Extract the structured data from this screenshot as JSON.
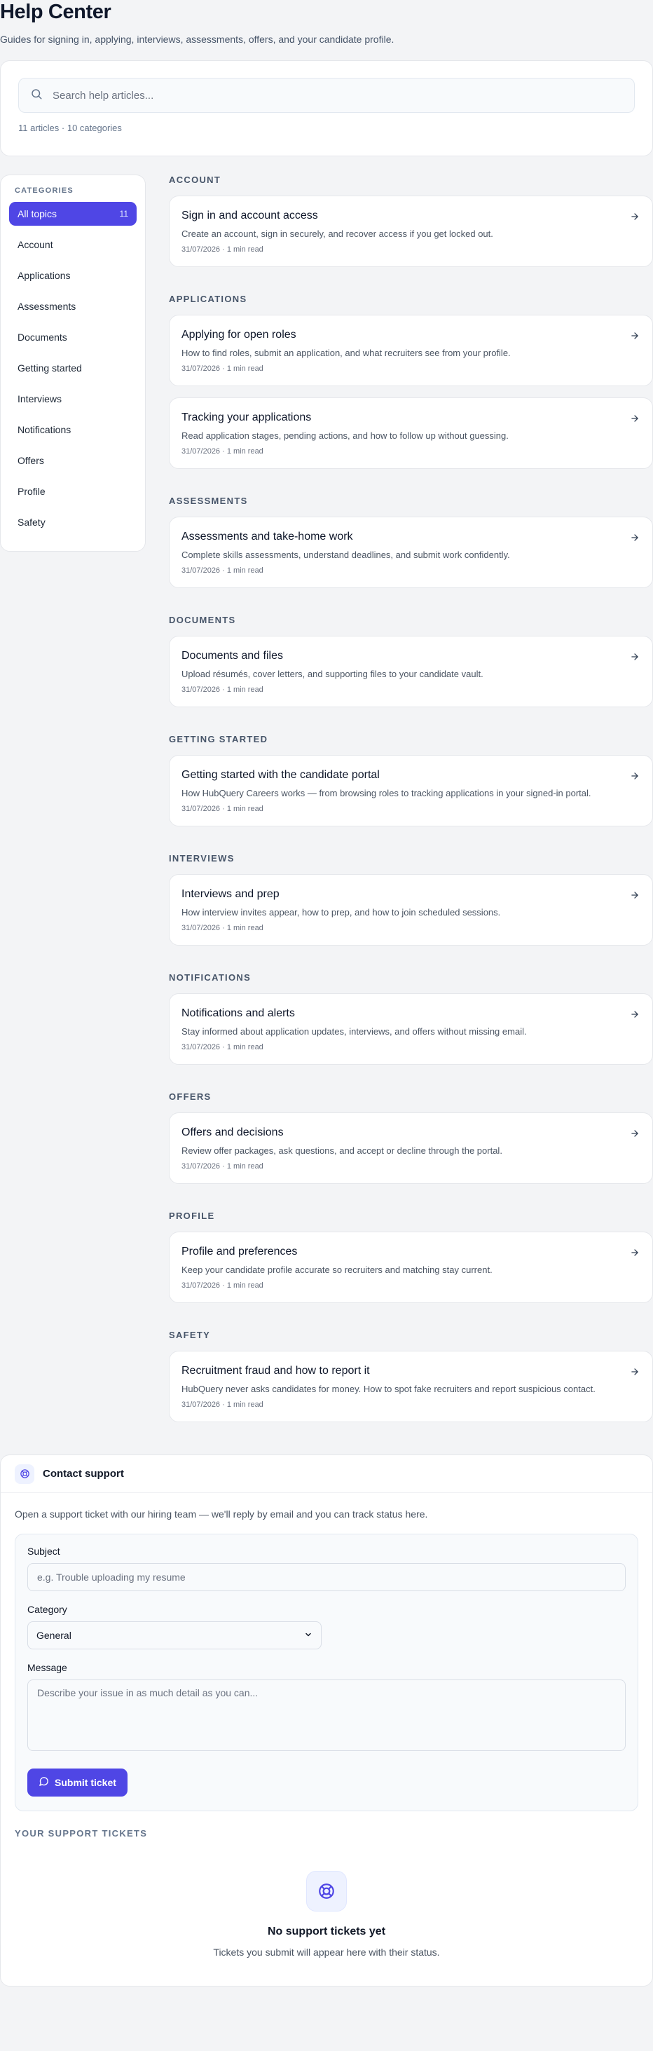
{
  "header": {
    "title": "Help Center",
    "subtitle": "Guides for signing in, applying, interviews, assessments, offers, and your candidate profile."
  },
  "search": {
    "placeholder": "Search help articles...",
    "meta": "11 articles · 10 categories"
  },
  "sidebar": {
    "heading": "CATEGORIES",
    "items": [
      {
        "label": "All topics",
        "count": "11",
        "active": true
      },
      {
        "label": "Account"
      },
      {
        "label": "Applications"
      },
      {
        "label": "Assessments"
      },
      {
        "label": "Documents"
      },
      {
        "label": "Getting started"
      },
      {
        "label": "Interviews"
      },
      {
        "label": "Notifications"
      },
      {
        "label": "Offers"
      },
      {
        "label": "Profile"
      },
      {
        "label": "Safety"
      }
    ]
  },
  "sections": [
    {
      "title": "ACCOUNT",
      "articles": [
        {
          "title": "Sign in and account access",
          "desc": "Create an account, sign in securely, and recover access if you get locked out.",
          "meta": "31/07/2026 · 1 min read"
        }
      ]
    },
    {
      "title": "APPLICATIONS",
      "articles": [
        {
          "title": "Applying for open roles",
          "desc": "How to find roles, submit an application, and what recruiters see from your profile.",
          "meta": "31/07/2026 · 1 min read"
        },
        {
          "title": "Tracking your applications",
          "desc": "Read application stages, pending actions, and how to follow up without guessing.",
          "meta": "31/07/2026 · 1 min read"
        }
      ]
    },
    {
      "title": "ASSESSMENTS",
      "articles": [
        {
          "title": "Assessments and take-home work",
          "desc": "Complete skills assessments, understand deadlines, and submit work confidently.",
          "meta": "31/07/2026 · 1 min read"
        }
      ]
    },
    {
      "title": "DOCUMENTS",
      "articles": [
        {
          "title": "Documents and files",
          "desc": "Upload résumés, cover letters, and supporting files to your candidate vault.",
          "meta": "31/07/2026 · 1 min read"
        }
      ]
    },
    {
      "title": "GETTING STARTED",
      "articles": [
        {
          "title": "Getting started with the candidate portal",
          "desc": "How HubQuery Careers works — from browsing roles to tracking applications in your signed-in portal.",
          "meta": "31/07/2026 · 1 min read"
        }
      ]
    },
    {
      "title": "INTERVIEWS",
      "articles": [
        {
          "title": "Interviews and prep",
          "desc": "How interview invites appear, how to prep, and how to join scheduled sessions.",
          "meta": "31/07/2026 · 1 min read"
        }
      ]
    },
    {
      "title": "NOTIFICATIONS",
      "articles": [
        {
          "title": "Notifications and alerts",
          "desc": "Stay informed about application updates, interviews, and offers without missing email.",
          "meta": "31/07/2026 · 1 min read"
        }
      ]
    },
    {
      "title": "OFFERS",
      "articles": [
        {
          "title": "Offers and decisions",
          "desc": "Review offer packages, ask questions, and accept or decline through the portal.",
          "meta": "31/07/2026 · 1 min read"
        }
      ]
    },
    {
      "title": "PROFILE",
      "articles": [
        {
          "title": "Profile and preferences",
          "desc": "Keep your candidate profile accurate so recruiters and matching stay current.",
          "meta": "31/07/2026 · 1 min read"
        }
      ]
    },
    {
      "title": "SAFETY",
      "articles": [
        {
          "title": "Recruitment fraud and how to report it",
          "desc": "HubQuery never asks candidates for money. How to spot fake recruiters and report suspicious contact.",
          "meta": "31/07/2026 · 1 min read"
        }
      ]
    }
  ],
  "support": {
    "title": "Contact support",
    "intro": "Open a support ticket with our hiring team — we'll reply by email and you can track status here.",
    "subject_label": "Subject",
    "subject_placeholder": "e.g. Trouble uploading my resume",
    "category_label": "Category",
    "category_value": "General",
    "message_label": "Message",
    "message_placeholder": "Describe your issue in as much detail as you can...",
    "submit_label": "Submit ticket",
    "tickets_heading": "YOUR SUPPORT TICKETS",
    "empty_title": "No support tickets yet",
    "empty_sub": "Tickets you submit will appear here with their status."
  },
  "colors": {
    "accent": "#4f46e5",
    "page_bg": "#f3f4f6"
  }
}
